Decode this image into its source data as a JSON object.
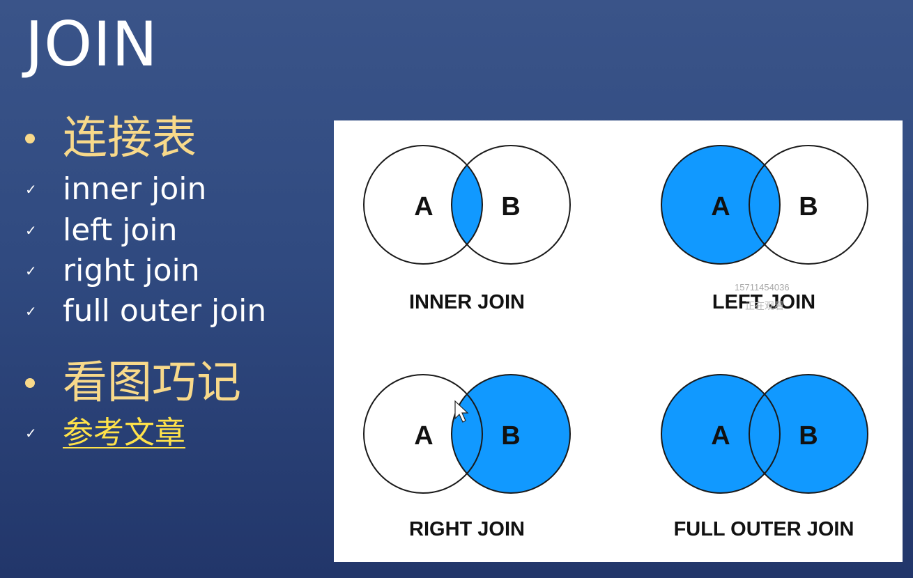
{
  "slide": {
    "title": "JOIN",
    "bullet1": "连接表",
    "join_types": [
      "inner join",
      "left join",
      "right join",
      "full outer join"
    ],
    "bullet2": "看图巧记",
    "link_label": "参考文章",
    "check_glyph": "✓"
  },
  "figure": {
    "circle_a": "A",
    "circle_b": "B",
    "fill_color": "#1199ff",
    "panels": [
      {
        "caption": "INNER JOIN",
        "fill": "intersection"
      },
      {
        "caption": "LEFT JOIN",
        "fill": "left"
      },
      {
        "caption": "RIGHT JOIN",
        "fill": "right"
      },
      {
        "caption": "FULL OUTER JOIN",
        "fill": "both"
      }
    ],
    "watermark_number": "15711454036",
    "watermark_text": "正在观看"
  }
}
